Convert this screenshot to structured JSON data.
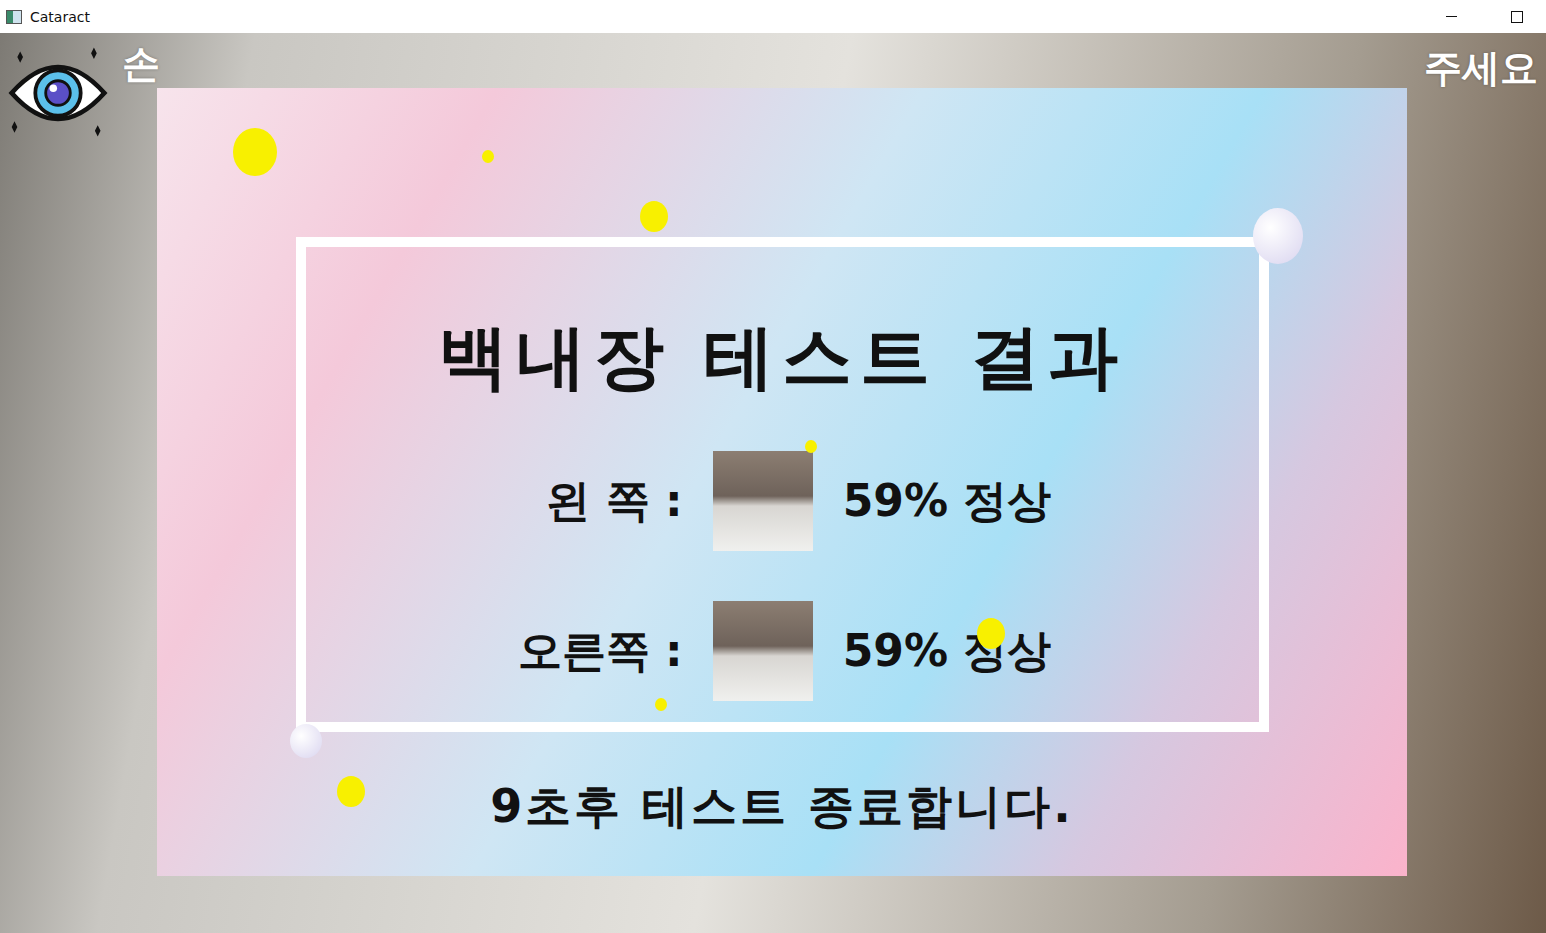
{
  "window": {
    "title": "Cataract"
  },
  "banner": {
    "fragments": [
      "손",
      "주세요"
    ]
  },
  "result": {
    "title": "백내장 테스트 결과",
    "rows": [
      {
        "label": "왼 쪽 :",
        "reading": "59% 정상"
      },
      {
        "label": "오른쪽 :",
        "reading": "59% 정상"
      }
    ],
    "footer": "9초후 테스트 종료합니다."
  }
}
